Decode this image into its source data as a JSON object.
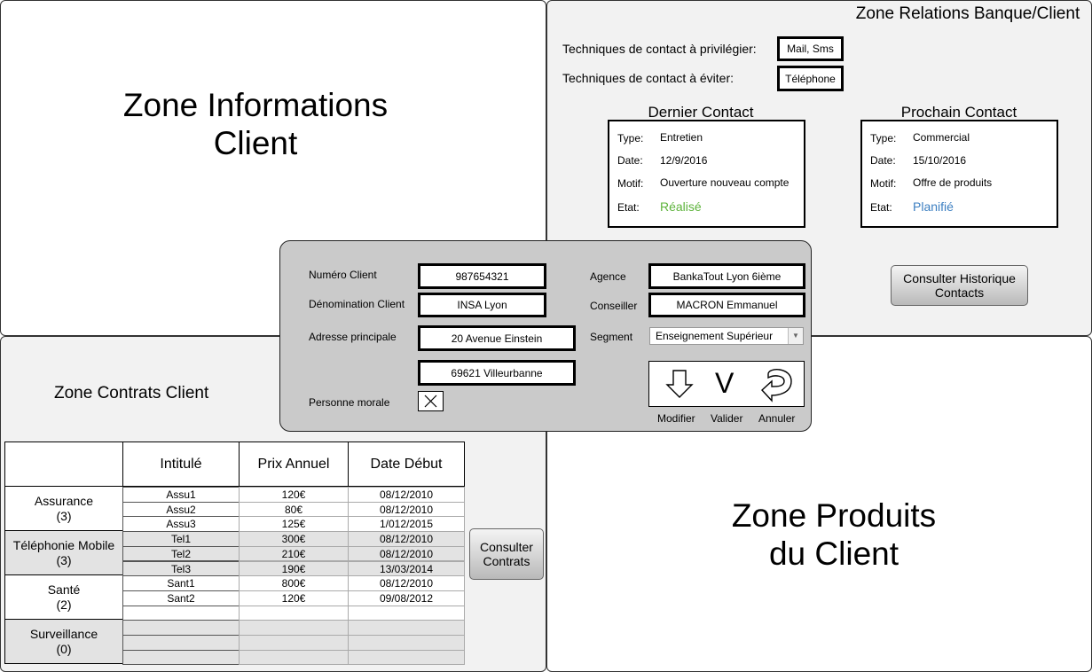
{
  "zone_info": {
    "title_line1": "Zone Informations",
    "title_line2": "Client"
  },
  "zone_relations": {
    "title": "Zone Relations Banque/Client",
    "preferred_label": "Techniques de contact à privilégier:",
    "preferred_value": "Mail, Sms",
    "avoid_label": "Techniques de contact à éviter:",
    "avoid_value": "Téléphone",
    "last_contact": {
      "title": "Dernier Contact",
      "type_label": "Type:",
      "type": "Entretien",
      "date_label": "Date:",
      "date": "12/9/2016",
      "motif_label": "Motif:",
      "motif": "Ouverture nouveau compte",
      "etat_label": "Etat:",
      "etat": "Réalisé"
    },
    "next_contact": {
      "title": "Prochain Contact",
      "type_label": "Type:",
      "type": "Commercial",
      "date_label": "Date:",
      "date": "15/10/2016",
      "motif_label": "Motif:",
      "motif": "Offre de produits",
      "etat_label": "Etat:",
      "etat": "Planifié"
    },
    "history_button_line1": "Consulter Historique",
    "history_button_line2": "Contacts"
  },
  "zone_products": {
    "title_line1": "Zone Produits",
    "title_line2": "du Client"
  },
  "zone_contracts": {
    "title": "Zone Contrats Client",
    "headers": [
      "Intitulé",
      "Prix Annuel",
      "Date Début"
    ],
    "categories": [
      {
        "name": "Assurance",
        "count": "(3)"
      },
      {
        "name": "Téléphonie Mobile",
        "count": "(3)"
      },
      {
        "name": "Santé",
        "count": "(2)"
      },
      {
        "name": "Surveillance",
        "count": "(0)"
      }
    ],
    "rows": [
      [
        "Assu1",
        "120€",
        "08/12/2010"
      ],
      [
        "Assu2",
        "80€",
        "08/12/2010"
      ],
      [
        "Assu3",
        "125€",
        "1/012/2015"
      ],
      [
        "Tel1",
        "300€",
        "08/12/2010"
      ],
      [
        "Tel2",
        "210€",
        "08/12/2010"
      ],
      [
        "Tel3",
        "190€",
        "13/03/2014"
      ],
      [
        "Sant1",
        "800€",
        "08/12/2010"
      ],
      [
        "Sant2",
        "120€",
        "09/08/2012"
      ],
      [
        "",
        "",
        ""
      ],
      [
        "",
        "",
        ""
      ],
      [
        "",
        "",
        ""
      ],
      [
        "",
        "",
        ""
      ]
    ],
    "consult_button_line1": "Consulter",
    "consult_button_line2": "Contrats"
  },
  "client_panel": {
    "numero_label": "Numéro Client",
    "numero_value": "987654321",
    "denomination_label": "Dénomination Client",
    "denomination_value": "INSA Lyon",
    "adresse_label": "Adresse principale",
    "adresse_line1": "20 Avenue Einstein",
    "adresse_line2": "69621 Villeurbanne",
    "personne_label": "Personne morale",
    "personne_checked": true,
    "agence_label": "Agence",
    "agence_value": "BankaTout Lyon 6ième",
    "conseiller_label": "Conseiller",
    "conseiller_value": "MACRON Emmanuel",
    "segment_label": "Segment",
    "segment_value": "Enseignement Supérieur",
    "modifier_label": "Modifier",
    "valider_label": "Valider",
    "annuler_label": "Annuler",
    "valider_symbol": "V"
  },
  "colors": {
    "realise": "#5db33b",
    "planifie": "#3c7fc1",
    "panel_bg": "#cacaca",
    "zone_bg": "#f2f2f2"
  }
}
